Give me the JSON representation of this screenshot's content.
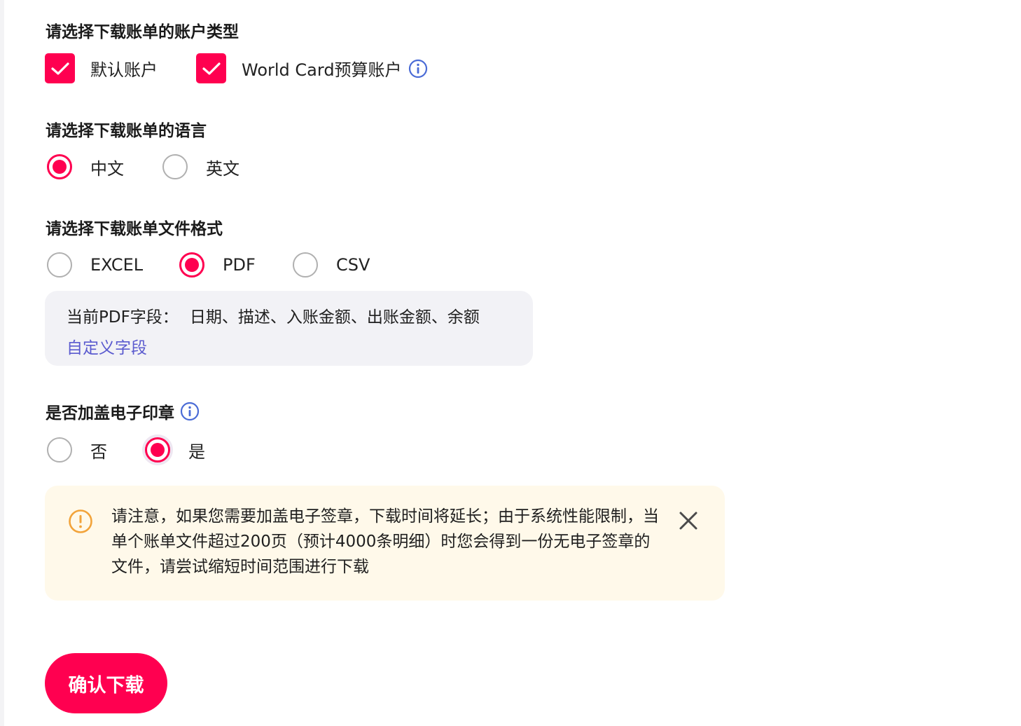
{
  "account_section": {
    "title": "请选择下载账单的账户类型",
    "options": [
      {
        "label": "默认账户",
        "checked": true
      },
      {
        "label": "World Card预算账户",
        "checked": true,
        "has_info_icon": true
      }
    ]
  },
  "language_section": {
    "title": "请选择下载账单的语言",
    "options": [
      {
        "label": "中文",
        "selected": true
      },
      {
        "label": "英文",
        "selected": false
      }
    ]
  },
  "format_section": {
    "title": "请选择下载账单文件格式",
    "options": [
      {
        "label": "EXCEL",
        "selected": false
      },
      {
        "label": "PDF",
        "selected": true
      },
      {
        "label": "CSV",
        "selected": false
      }
    ],
    "field_box": {
      "prefix": "当前PDF字段：",
      "fields": "日期、描述、入账金额、出账金额、余额",
      "customize_link": "自定义字段"
    }
  },
  "seal_section": {
    "title": "是否加盖电子印章",
    "options": [
      {
        "label": "否",
        "selected": false
      },
      {
        "label": "是",
        "selected": true
      }
    ]
  },
  "notice": {
    "text": "请注意，如果您需要加盖电子签章，下载时间将延长；由于系统性能限制，当单个账单文件超过200页（预计4000条明细）时您会得到一份无电子签章的文件，请尝试缩短时间范围进行下载"
  },
  "confirm_button": {
    "label": "确认下载"
  },
  "colors": {
    "accent": "#ff0050",
    "info_icon": "#4a6bd6",
    "link": "#5b5bcf",
    "field_box_bg": "#f2f2f6",
    "notice_bg": "#fff9ea",
    "warning_icon": "#f2a33a"
  }
}
